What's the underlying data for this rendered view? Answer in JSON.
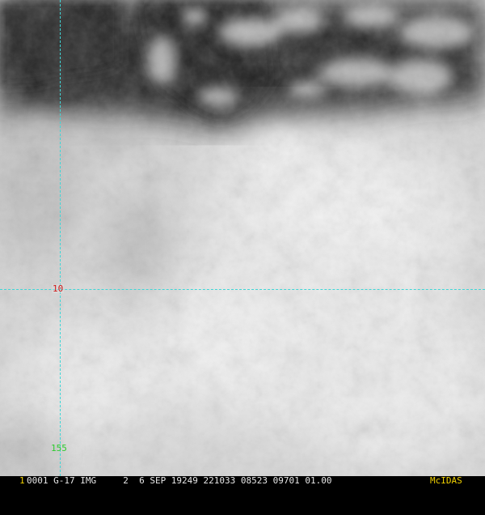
{
  "grid": {
    "lat_label": "10",
    "lon_label": "155",
    "line_color": "#3fd6d6",
    "lat_label_color": "#d01818",
    "lon_label_color": "#2ecc2e"
  },
  "status_bar": {
    "frame_number": "1",
    "text": "0001 G-17 IMG     2  6 SEP 19249 221033 08523 09701 01.00",
    "brand": "McIDAS",
    "frame_color": "#f0d000",
    "brand_color": "#f0d000"
  },
  "imagery": {
    "description_icon": "satellite-cloud-imagery"
  }
}
